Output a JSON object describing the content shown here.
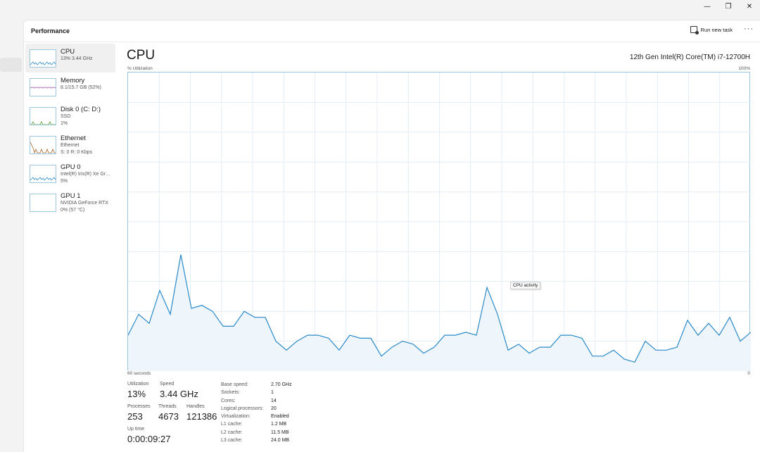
{
  "window": {
    "caption_buttons": [
      {
        "name": "minimize-button",
        "glyph": "—"
      },
      {
        "name": "restore-button",
        "glyph": "❐"
      },
      {
        "name": "close-button",
        "glyph": "✕"
      }
    ]
  },
  "header": {
    "title": "Performance",
    "run_new_task": "Run new task",
    "more_glyph": "···"
  },
  "resources": [
    {
      "name": "CPU",
      "lines": [
        "13%  3.44 GHz"
      ],
      "active": true,
      "color": "#2a8ac9",
      "icon": "cpu-thumbnail-icon"
    },
    {
      "name": "Memory",
      "lines": [
        "8.1/15.7 GB (52%)"
      ],
      "active": false,
      "color": "#a04ea6",
      "icon": "memory-thumbnail-icon"
    },
    {
      "name": "Disk 0 (C: D:)",
      "lines": [
        "SSD",
        "1%"
      ],
      "active": false,
      "color": "#4d9a24",
      "icon": "disk-thumbnail-icon"
    },
    {
      "name": "Ethernet",
      "lines": [
        "Ethernet",
        "S: 0 R: 0 Kbps"
      ],
      "active": false,
      "color": "#a7652a",
      "icon": "ethernet-thumbnail-icon"
    },
    {
      "name": "GPU 0",
      "lines": [
        "Intel(R) Iris(R) Xe Graphics",
        "5%"
      ],
      "active": false,
      "color": "#2a8ac9",
      "icon": "gpu0-thumbnail-icon"
    },
    {
      "name": "GPU 1",
      "lines": [
        "NVIDIA GeForce RTX",
        "0%  (57 °C)"
      ],
      "active": false,
      "color": "#2a8ac9",
      "icon": "gpu1-thumbnail-icon"
    }
  ],
  "cpu": {
    "title": "CPU",
    "model": "12th Gen Intel(R) Core(TM) i7-12700H",
    "y_label": "% Utilization",
    "y_max_label": "100%",
    "x_left_label": "60 seconds",
    "x_right_label": "0",
    "tooltip": "CPU activity",
    "stats": {
      "utilization": {
        "label": "Utilization",
        "value": "13%"
      },
      "speed": {
        "label": "Speed",
        "value": "3.44 GHz"
      },
      "processes": {
        "label": "Processes",
        "value": "253"
      },
      "threads": {
        "label": "Threads",
        "value": "4673"
      },
      "handles": {
        "label": "Handles",
        "value": "121386"
      },
      "uptime": {
        "label": "Up time",
        "value": "0:00:09:27"
      }
    },
    "specs": [
      {
        "k": "Base speed:",
        "v": "2.70 GHz"
      },
      {
        "k": "Sockets:",
        "v": "1"
      },
      {
        "k": "Cores:",
        "v": "14"
      },
      {
        "k": "Logical processors:",
        "v": "20"
      },
      {
        "k": "Virtualization:",
        "v": "Enabled"
      },
      {
        "k": "L1 cache:",
        "v": "1.2 MB"
      },
      {
        "k": "L2 cache:",
        "v": "11.5 MB"
      },
      {
        "k": "L3 cache:",
        "v": "24.0 MB"
      }
    ]
  },
  "chart_data": {
    "type": "area",
    "ylim": [
      0,
      100
    ],
    "xlim": [
      60,
      0
    ],
    "grid": true,
    "line_color": "#2a8ac9",
    "fill_color": "#eef5fb",
    "values": [
      12,
      19,
      16,
      27,
      19,
      39,
      21,
      22,
      20,
      15,
      15,
      20,
      18,
      18,
      10,
      7,
      10,
      12,
      12,
      11,
      7,
      12,
      11,
      11,
      5,
      8,
      10,
      9,
      6,
      8,
      12,
      12,
      13,
      12,
      28,
      19,
      7,
      9,
      6,
      8,
      8,
      12,
      12,
      11,
      5,
      5,
      7,
      4,
      3,
      10,
      7,
      7,
      8,
      17,
      12,
      16,
      12,
      18,
      10,
      13
    ]
  }
}
